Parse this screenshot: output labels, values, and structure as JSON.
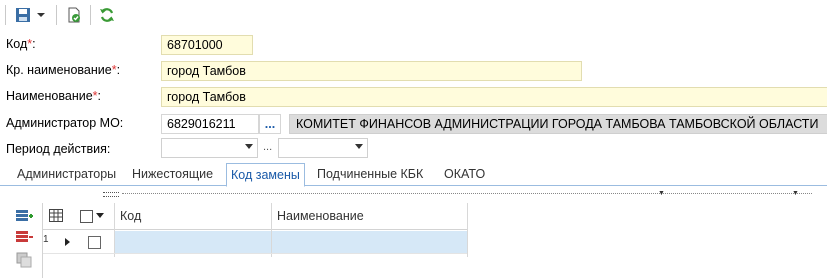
{
  "toolbar": {
    "save_icon": "save-icon",
    "dropdown_icon": "chevron-down-icon",
    "check_doc_icon": "check-document-icon",
    "refresh_icon": "refresh-icon"
  },
  "form": {
    "code": {
      "label": "Код",
      "required_mark": "*",
      "value": "68701000"
    },
    "short_name": {
      "label": "Кр. наименование",
      "required_mark": "*",
      "value": "город Тамбов"
    },
    "name": {
      "label": "Наименование",
      "required_mark": "*",
      "value": "город Тамбов"
    },
    "admin_mo": {
      "label": "Администратор МО:",
      "value": "6829016211",
      "lookup_label": "...",
      "description": "КОМИТЕТ ФИНАНСОВ АДМИНИСТРАЦИИ ГОРОДА ТАМБОВА ТАМБОВСКОЙ ОБЛАСТИ"
    },
    "period": {
      "label": "Период действия:",
      "separator": "...",
      "from": "",
      "to": ""
    }
  },
  "tabs": [
    {
      "label": "Администраторы"
    },
    {
      "label": "Нижестоящие"
    },
    {
      "label": "Код замены"
    },
    {
      "label": "Подчиненные КБК"
    },
    {
      "label": "ОКАТО"
    }
  ],
  "active_tab": "Код замены",
  "grid": {
    "columns": [
      "Код",
      "Наименование"
    ],
    "rows": [
      {
        "num": "1",
        "code": "",
        "name": ""
      }
    ]
  },
  "colors": {
    "accent": "#1a5aa8",
    "required": "#d33333",
    "selected_row": "#d6e8f7",
    "yellow_field": "#fffcdc"
  }
}
